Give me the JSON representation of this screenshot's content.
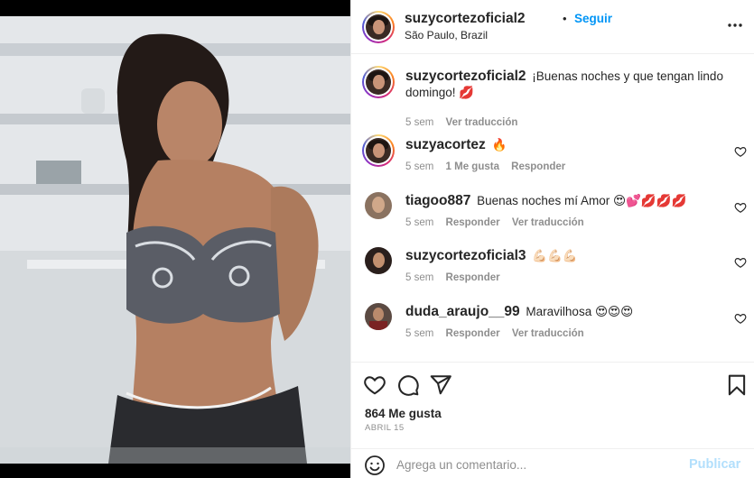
{
  "post": {
    "author": "suzycortezoficial2",
    "separator": "•",
    "follow_label": "Seguir",
    "location": "São Paulo, Brazil",
    "more_icon": "more-horizontal-icon"
  },
  "comments": [
    {
      "username": "suzycortezoficial2",
      "text": "¡Buenas noches y que tengan lindo domingo! 💋",
      "time": "5 sem",
      "actions": [
        "Ver traducción"
      ],
      "avatar": "story-ring",
      "has_heart": false
    },
    {
      "username": "suzyacortez",
      "text": "🔥",
      "time": "5 sem",
      "likes": "1 Me gusta",
      "actions": [
        "Responder"
      ],
      "avatar": "story-ring",
      "has_heart": true
    },
    {
      "username": "tiagoo887",
      "text": "Buenas noches mí Amor 😍💕💋💋💋",
      "time": "5 sem",
      "actions": [
        "Responder",
        "Ver traducción"
      ],
      "avatar": "plain",
      "has_heart": true
    },
    {
      "username": "suzycortezoficial3",
      "text": "💪🏻💪🏻💪🏻",
      "time": "5 sem",
      "actions": [
        "Responder"
      ],
      "avatar": "plain",
      "has_heart": true
    },
    {
      "username": "duda_araujo__99",
      "text": "Maravilhosa 😍😍😍",
      "time": "5 sem",
      "actions": [
        "Responder",
        "Ver traducción"
      ],
      "avatar": "plain",
      "has_heart": true
    }
  ],
  "actions": {
    "like_icon": "heart-icon",
    "comment_icon": "comment-icon",
    "share_icon": "send-icon",
    "save_icon": "bookmark-icon"
  },
  "likes_label": "864 Me gusta",
  "date_label": "ABRIL 15",
  "composer": {
    "placeholder": "Agrega un comentario...",
    "publish_label": "Publicar",
    "emoji_icon": "smiley-icon"
  },
  "colors": {
    "link_blue": "#0095f6",
    "publish_disabled": "#b2dffc",
    "muted": "#8e8e8e",
    "text": "#262626"
  }
}
